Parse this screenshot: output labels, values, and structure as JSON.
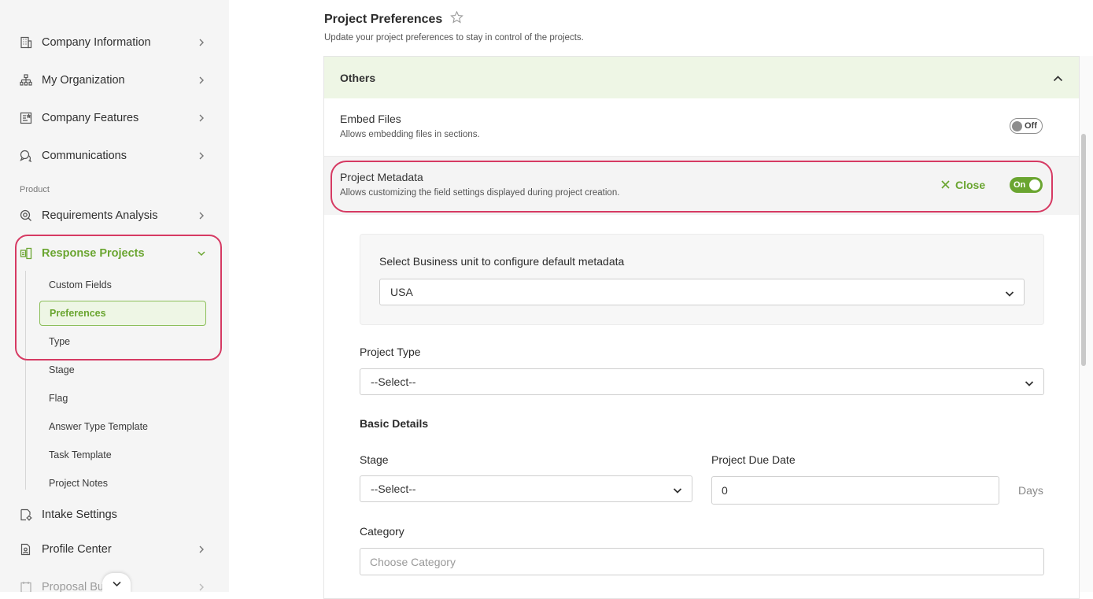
{
  "sidebar": {
    "items": [
      {
        "label": "Company Information",
        "icon": "building-icon"
      },
      {
        "label": "My Organization",
        "icon": "org-chart-icon"
      },
      {
        "label": "Company Features",
        "icon": "feature-list-icon"
      },
      {
        "label": "Communications",
        "icon": "chat-bubbles-icon"
      }
    ],
    "section_label": "Product",
    "requirements_label": "Requirements Analysis",
    "response_projects_label": "Response Projects",
    "sub_items": [
      "Custom Fields",
      "Preferences",
      "Type",
      "Stage",
      "Flag",
      "Answer Type Template",
      "Task Template",
      "Project Notes"
    ],
    "active_sub_item": "Preferences",
    "intake_label": "Intake Settings",
    "profile_label": "Profile Center",
    "proposal_label": "Proposal Bu"
  },
  "header": {
    "title": "Project Preferences",
    "subtitle": "Update your project preferences to stay in control of the projects."
  },
  "panel": {
    "title": "Others",
    "embed": {
      "title": "Embed Files",
      "description": "Allows embedding files in sections.",
      "toggle_label": "Off",
      "state": "off"
    },
    "metadata": {
      "title": "Project Metadata",
      "description": "Allows customizing the field settings displayed during project creation.",
      "close_label": "Close",
      "toggle_label": "On",
      "state": "on"
    }
  },
  "form": {
    "business_unit_label": "Select Business unit to configure default metadata",
    "business_unit_value": "USA",
    "project_type_label": "Project Type",
    "project_type_value": "--Select--",
    "basic_details_label": "Basic Details",
    "stage_label": "Stage",
    "stage_value": "--Select--",
    "due_date_label": "Project Due Date",
    "due_date_value": "0",
    "due_date_unit": "Days",
    "category_label": "Category",
    "category_placeholder": "Choose Category"
  },
  "colors": {
    "accent": "#6aa530",
    "highlight": "#d63a63",
    "panel_header_bg": "#eef6e5"
  }
}
